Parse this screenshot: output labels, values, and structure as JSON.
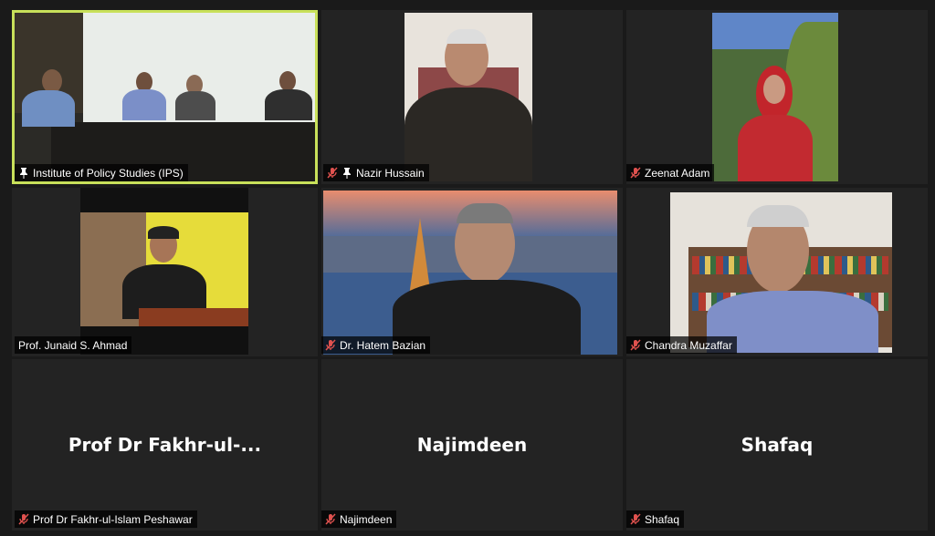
{
  "tiles": [
    {
      "name": "Institute of Policy Studies (IPS)",
      "muted": false,
      "pinned": true,
      "active": true
    },
    {
      "name": "Nazir Hussain",
      "muted": true,
      "pinned": true
    },
    {
      "name": "Zeenat Adam",
      "muted": true
    },
    {
      "name": "Prof. Junaid S. Ahmad",
      "muted": false
    },
    {
      "name": "Dr. Hatem Bazian",
      "muted": true
    },
    {
      "name": "Chandra Muzaffar",
      "muted": true
    },
    {
      "name": "Prof Dr Fakhr-ul-Islam Peshawar",
      "display": "Prof Dr Fakhr-ul-...",
      "muted": true
    },
    {
      "name": "Najimdeen",
      "display": "Najimdeen",
      "muted": true
    },
    {
      "name": "Shafaq",
      "display": "Shafaq",
      "muted": true
    }
  ],
  "colors": {
    "active_border": "#c8e05a",
    "muted_icon": "#e0524f",
    "tile_bg": "#232323"
  }
}
